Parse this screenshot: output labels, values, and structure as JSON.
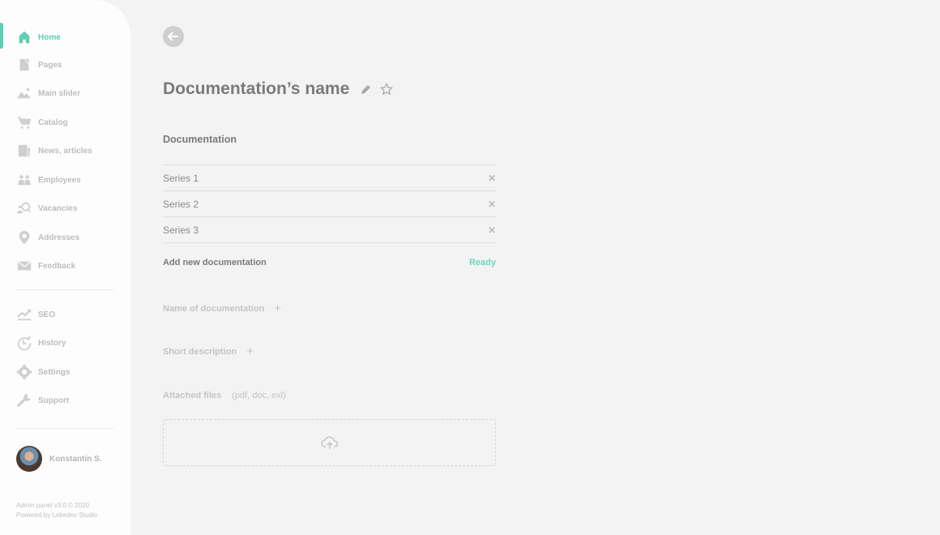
{
  "sidebar": {
    "items": [
      {
        "label": "Home",
        "icon": "home-icon",
        "active": true
      },
      {
        "label": "Pages",
        "icon": "pages-icon"
      },
      {
        "label": "Main slider",
        "icon": "image-icon"
      },
      {
        "label": "Catalog",
        "icon": "cart-icon"
      },
      {
        "label": "News, articles",
        "icon": "news-icon"
      },
      {
        "label": "Employees",
        "icon": "employees-icon"
      },
      {
        "label": "Vacancies",
        "icon": "vacancies-icon"
      },
      {
        "label": "Addresses",
        "icon": "location-icon"
      },
      {
        "label": "Feedback",
        "icon": "mail-icon"
      },
      {
        "label": "SEO",
        "icon": "trend-icon"
      },
      {
        "label": "History",
        "icon": "history-icon"
      },
      {
        "label": "Settings",
        "icon": "gear-icon"
      },
      {
        "label": "Support",
        "icon": "wrench-icon"
      }
    ],
    "user": {
      "name": "Konstantin S."
    },
    "footer": {
      "line1": "Admin panel v3.0 © 2020",
      "line2": "Powered by Lebedev Studio"
    }
  },
  "main": {
    "title": "Documentation’s name",
    "section": "Documentation",
    "series": [
      "Series 1",
      "Series 2",
      "Series 3"
    ],
    "add_label": "Add new documentation",
    "ready_label": "Ready",
    "name_field": "Name of documentation",
    "short_desc": "Short description",
    "attached": "Attached files",
    "attached_hint": "(pdf, doc, exl)",
    "accent": "#5ecfb1"
  }
}
